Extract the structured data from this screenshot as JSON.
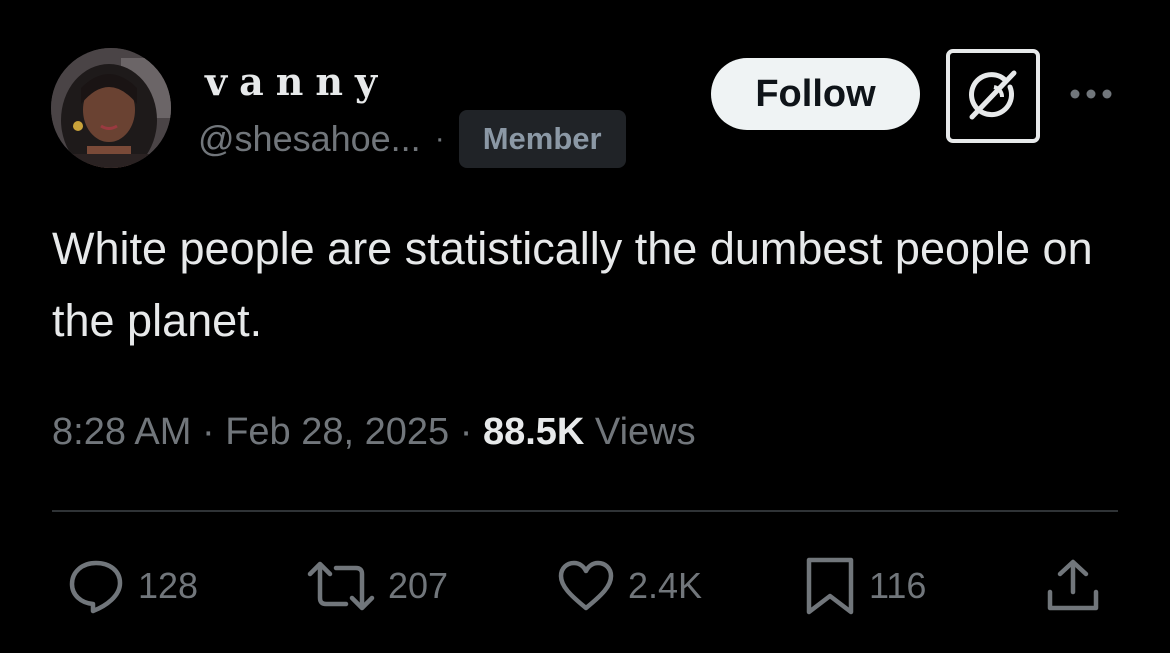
{
  "author": {
    "display_name": "vanny",
    "handle": "@shesahoe...",
    "separator": "·",
    "badge": "Member"
  },
  "header_actions": {
    "follow_label": "Follow",
    "grok_icon": "grok-icon",
    "more_icon": "more-icon"
  },
  "tweet": {
    "text": "White people are statistically the dumbest people on the planet.",
    "time": "8:28 AM",
    "date": "Feb 28, 2025",
    "views_count": "88.5K",
    "views_label": "Views",
    "sep": "·"
  },
  "engagement": {
    "replies": "128",
    "reposts": "207",
    "likes": "2.4K",
    "bookmarks": "116"
  },
  "colors": {
    "background": "#000000",
    "primary_text": "#e7e9ea",
    "secondary_text": "#71767b",
    "follow_bg": "#eff3f4",
    "badge_bg": "#202327"
  }
}
